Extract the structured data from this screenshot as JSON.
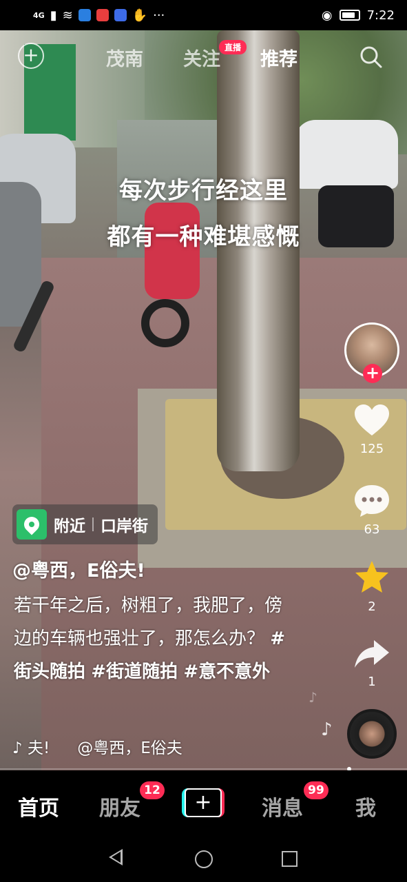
{
  "status_bar": {
    "signal": "4G",
    "time": "7:22"
  },
  "overlay": {
    "line1": "每次步行经这里",
    "line2": "都有一种难堪感慨"
  },
  "top_tabs": {
    "local": "茂南",
    "following": "关注",
    "live_badge": "直播",
    "recommended": "推荐"
  },
  "actions": {
    "likes": "125",
    "comments": "63",
    "favorites": "2",
    "shares": "1"
  },
  "location": {
    "nearby": "附近",
    "place": "口岸街"
  },
  "post": {
    "author": "@粤西，E俗夫!",
    "text": "若干年之后，树粗了，我肥了，傍边的车辆也强壮了，那怎么办？",
    "tag1": "#街头随拍",
    "tag2": "#街道随拍",
    "tag3": "#意不意外",
    "music_left": "♪ 夫!",
    "music_right": "@粤西，E俗夫"
  },
  "bottom_nav": {
    "home": "首页",
    "friends": "朋友",
    "friends_badge": "12",
    "create": "+",
    "messages": "消息",
    "messages_badge": "99",
    "me": "我"
  },
  "colors": {
    "accent": "#fe2c55",
    "location_green": "#2cbf6a",
    "star": "#f7c21e"
  }
}
